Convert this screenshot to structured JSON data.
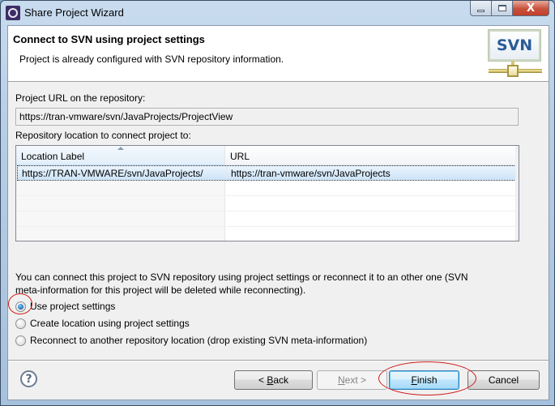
{
  "window": {
    "title": "Share Project Wizard",
    "app_icon": "eclipse-gear-icon",
    "controls": {
      "minimize": "minimize",
      "maximize": "maximize",
      "close": "X"
    }
  },
  "header": {
    "title": "Connect to SVN using project settings",
    "description": "Project is already configured with SVN repository information.",
    "logo_text": "SVN"
  },
  "project_url": {
    "label": "Project URL on the repository:",
    "value": "https://tran-vmware/svn/JavaProjects/ProjectView"
  },
  "repository": {
    "label": "Repository location to connect project to:",
    "columns": [
      "Location Label",
      "URL"
    ],
    "sorted_column": "Location Label",
    "rows": [
      {
        "label": "https://TRAN-VMWARE/svn/JavaProjects/",
        "url": "https://tran-vmware/svn/JavaProjects",
        "selected": true
      }
    ]
  },
  "info_text": "You can connect this project to SVN repository using project settings or reconnect it to an other one (SVN meta-information for this project will be deleted while reconnecting).",
  "options": [
    {
      "label": "Use project settings",
      "checked": true
    },
    {
      "label": "Create location using project settings",
      "checked": false
    },
    {
      "label": "Reconnect to another repository location (drop existing SVN meta-information)",
      "checked": false
    }
  ],
  "buttons": {
    "help": "?",
    "back": {
      "prefix": "< ",
      "mnemonic": "B",
      "rest": "ack",
      "enabled": true
    },
    "next": {
      "mnemonic": "N",
      "rest": "ext >",
      "enabled": false
    },
    "finish": {
      "mnemonic": "F",
      "rest": "inish",
      "enabled": true,
      "default": true
    },
    "cancel": {
      "label": "Cancel",
      "enabled": true
    }
  },
  "annotations": {
    "color": "#d01818",
    "highlighted": [
      "Use project settings radio",
      "Finish button"
    ]
  }
}
